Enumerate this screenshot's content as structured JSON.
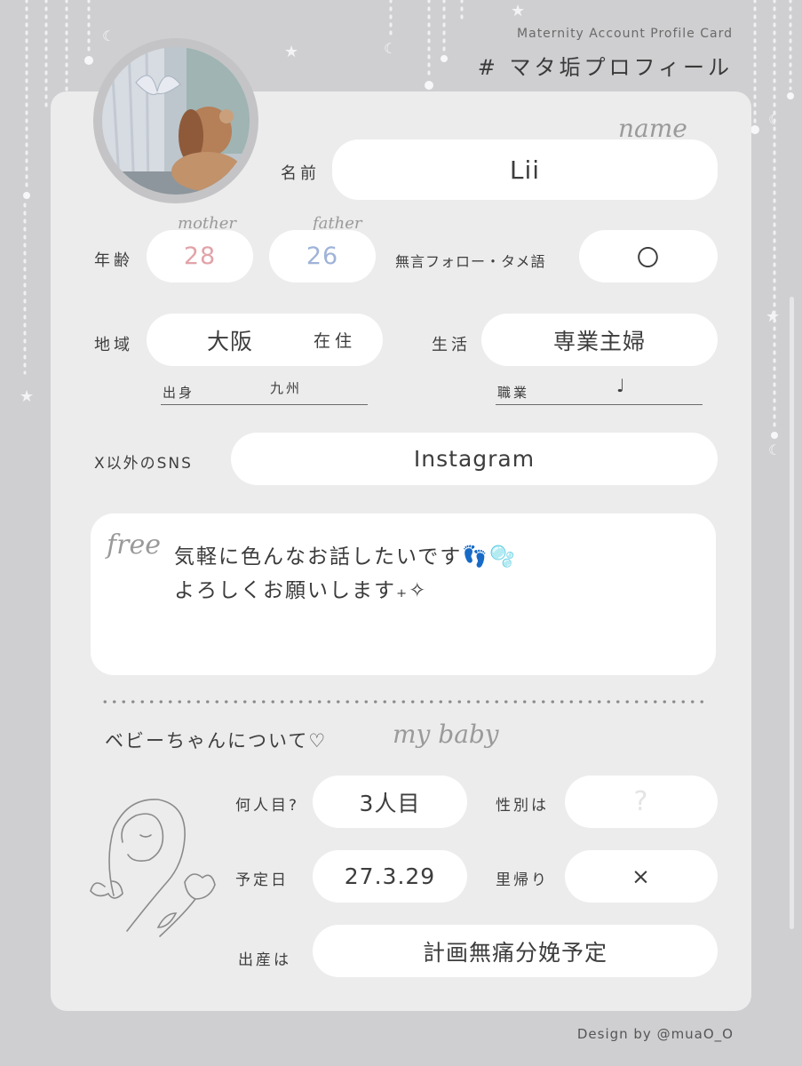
{
  "header": {
    "subtitle_en": "Maternity Account Profile Card",
    "title_jp": "# マタ垢プロフィール"
  },
  "profile": {
    "name_script": "name",
    "name_label": "名前",
    "name_value": "Lii",
    "age_label": "年齢",
    "mother_script": "mother",
    "father_script": "father",
    "mother_age": "28",
    "father_age": "26",
    "silent_follow_label": "無言フォロー・タメ語",
    "silent_follow_value": "〇",
    "region_label": "地域",
    "region_value": "大阪",
    "region_suffix": "在住",
    "hometown_label": "出身",
    "hometown_value": "九州",
    "life_label": "生活",
    "life_value": "専業主婦",
    "job_label": "職業",
    "job_value": "♩",
    "sns_label": "X以外のSNS",
    "sns_value": "Instagram",
    "free_script": "free",
    "free_text": "気軽に色んなお話したいです👣🫧\nよろしくお願いします₊✧"
  },
  "baby": {
    "section_title": "ベビーちゃんについて♡",
    "section_script": "my baby",
    "order_label": "何人目?",
    "order_value": "3人目",
    "gender_label": "性別は",
    "gender_value": "?",
    "due_label": "予定日",
    "due_value": "27.3.29",
    "homecoming_label": "里帰り",
    "homecoming_value": "×",
    "birth_label": "出産は",
    "birth_value": "計画無痛分娩予定"
  },
  "footer": {
    "credit": "Design by @muaO_O"
  },
  "colors": {
    "background": "#cfcfd1",
    "card": "#ececed",
    "pill": "#ffffff",
    "mother_age": "#e2a3a8",
    "father_age": "#9fb3d8"
  }
}
